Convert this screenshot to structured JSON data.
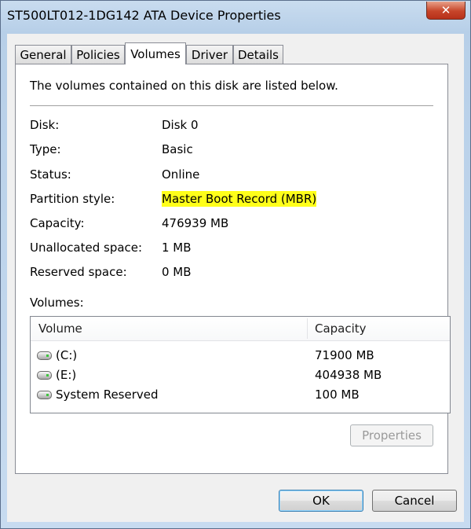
{
  "window": {
    "title": "ST500LT012-1DG142 ATA Device Properties",
    "close_symbol": "✕"
  },
  "tabs": [
    {
      "label": "General"
    },
    {
      "label": "Policies"
    },
    {
      "label": "Volumes",
      "active": true
    },
    {
      "label": "Driver"
    },
    {
      "label": "Details"
    }
  ],
  "volumes_tab": {
    "intro": "The volumes contained on this disk are listed below.",
    "properties": [
      {
        "label": "Disk:",
        "value": "Disk 0"
      },
      {
        "label": "Type:",
        "value": "Basic"
      },
      {
        "label": "Status:",
        "value": "Online"
      },
      {
        "label": "Partition style:",
        "value": "Master Boot Record (MBR)",
        "highlighted": true
      },
      {
        "label": "Capacity:",
        "value": "476939 MB"
      },
      {
        "label": "Unallocated space:",
        "value": "1 MB"
      },
      {
        "label": "Reserved space:",
        "value": "0 MB"
      }
    ],
    "volumes_label": "Volumes:",
    "columns": [
      "Volume",
      "Capacity"
    ],
    "volumes": [
      {
        "name": "(C:)",
        "capacity": "71900 MB",
        "icon": "drive-icon"
      },
      {
        "name": "(E:)",
        "capacity": "404938 MB",
        "icon": "drive-icon"
      },
      {
        "name": "System Reserved",
        "capacity": "100 MB",
        "icon": "drive-icon"
      }
    ],
    "properties_button": "Properties"
  },
  "footer": {
    "ok": "OK",
    "cancel": "Cancel"
  },
  "colors": {
    "highlight": "#ffff1a",
    "titlebar": "#b7cfe8",
    "close_button": "#c7452a"
  }
}
